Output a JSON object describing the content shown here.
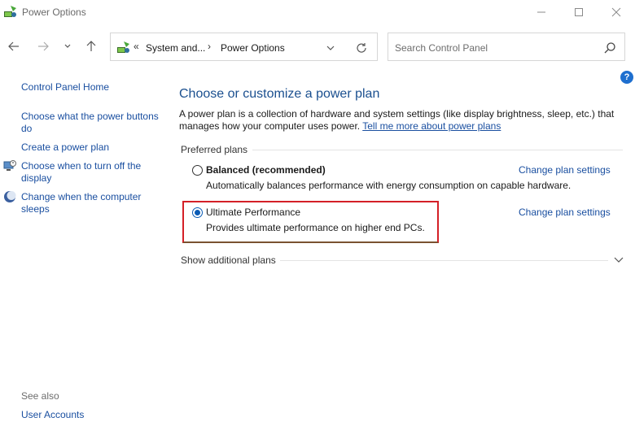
{
  "window": {
    "title": "Power Options",
    "app_icon": "power-options-icon",
    "controls": [
      "minimize-icon",
      "maximize-icon",
      "close-icon"
    ]
  },
  "nav": {
    "back_icon": "arrow-left-icon",
    "forward_icon": "arrow-right-icon",
    "recent_icon": "chevron-down-icon",
    "up_icon": "arrow-up-icon",
    "address": {
      "overflow": "«",
      "crumbs": [
        "System and...",
        "Power Options"
      ],
      "separator": "›"
    },
    "refresh_icon": "refresh-icon",
    "search": {
      "placeholder": "Search Control Panel",
      "icon": "search-icon"
    }
  },
  "help_icon": "?",
  "sidebar": {
    "home": "Control Panel Home",
    "links": [
      "Choose what the power buttons do",
      "Create a power plan",
      "Choose when to turn off the display",
      "Change when the computer sleeps"
    ],
    "see_also_label": "See also",
    "see_also_links": [
      "User Accounts"
    ]
  },
  "main": {
    "heading": "Choose or customize a power plan",
    "description": "A power plan is a collection of hardware and system settings (like display brightness, sleep, etc.) that manages how your computer uses power. ",
    "description_link": "Tell me more about power plans",
    "preferred_label": "Preferred plans",
    "plans": [
      {
        "name": "Balanced (recommended)",
        "description": "Automatically balances performance with energy consumption on capable hardware.",
        "change_label": "Change plan settings",
        "selected": false
      },
      {
        "name": "Ultimate Performance",
        "description": "Provides ultimate performance on higher end PCs.",
        "change_label": "Change plan settings",
        "selected": true
      }
    ],
    "show_additional": "Show additional plans"
  },
  "colors": {
    "link": "#1a4fa0",
    "heading": "#1a4f8f",
    "highlight_box": "#d42027",
    "radio_selected": "#0a5bb5"
  }
}
